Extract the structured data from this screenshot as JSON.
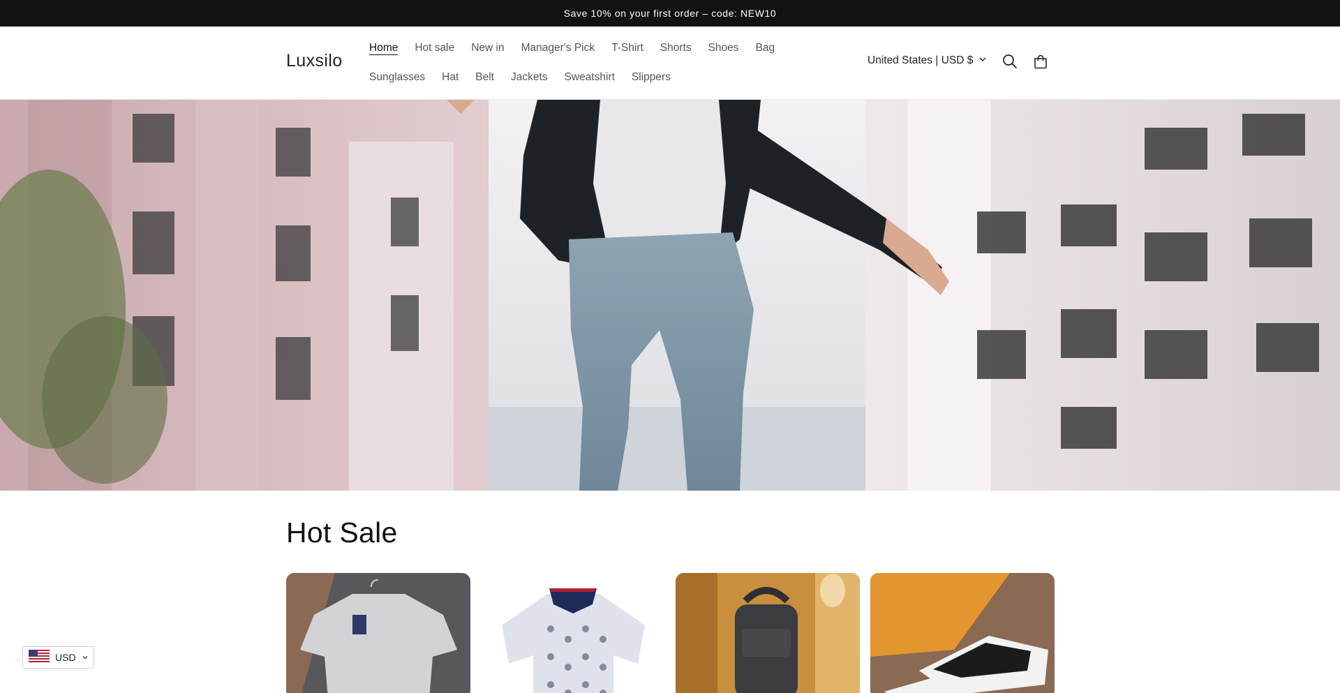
{
  "announcement": {
    "text": "Save 10% on your first order – code: NEW10"
  },
  "header": {
    "logo": "Luxsilo",
    "nav_row1": [
      "Home",
      "Hot sale",
      "New in",
      "Manager's Pick",
      "T-Shirt",
      "Shorts",
      "Shoes",
      "Bag"
    ],
    "nav_row2": [
      "Sunglasses",
      "Hat",
      "Belt",
      "Jackets",
      "Sweatshirt",
      "Slippers"
    ],
    "active_nav": "Home",
    "locale_label": "United States | USD $",
    "icons": [
      "chevron-down-icon",
      "search-icon",
      "cart-icon"
    ]
  },
  "hot_sale": {
    "title": "Hot Sale"
  },
  "currency_switcher": {
    "label": "USD",
    "flag": "us-flag-icon"
  },
  "colors": {
    "announcement_bg": "#121212",
    "text": "#121212",
    "nav_text": "#555555"
  }
}
